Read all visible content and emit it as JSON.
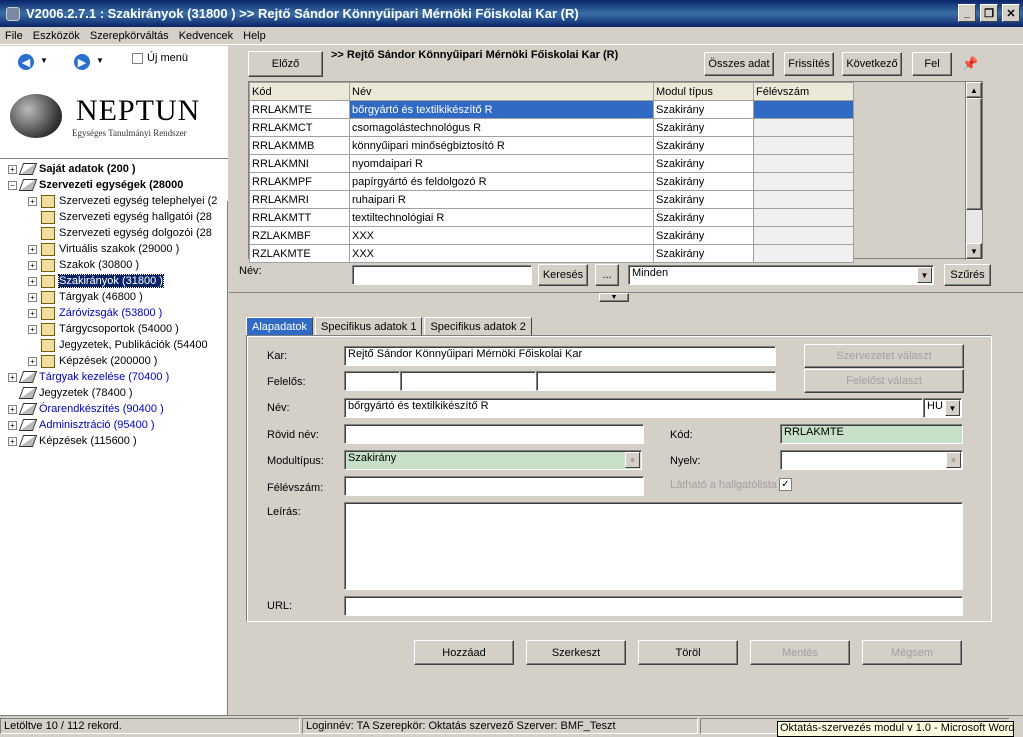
{
  "window": {
    "title": "V2006.2.7.1 : Szakirányok (31800  )  >> Rejtő Sándor Könnyűipari Mérnöki Főiskolai Kar (R)"
  },
  "menu": [
    "File",
    "Eszközök",
    "Szerepkörváltás",
    "Kedvencek",
    "Help"
  ],
  "nav": {
    "uj_menu_label": "Új menü",
    "logo_title": "NEPTUN",
    "logo_subtitle": "Egységes Tanulmányi Rendszer"
  },
  "tree": [
    {
      "label": "Saját adatok (200  )",
      "level": 0,
      "exp": "+",
      "bold": true
    },
    {
      "label": "Szervezeti egységek (28000",
      "level": 0,
      "exp": "−",
      "bold": true
    },
    {
      "label": "Szervezeti egység telephelyei (2",
      "level": 1,
      "exp": "+"
    },
    {
      "label": "Szervezeti egység hallgatói (28",
      "level": 1,
      "exp": ""
    },
    {
      "label": "Szervezeti egység dolgozói (28",
      "level": 1,
      "exp": ""
    },
    {
      "label": "Virtuális szakok (29000  )",
      "level": 1,
      "exp": "+"
    },
    {
      "label": "Szakok (30800  )",
      "level": 1,
      "exp": "+"
    },
    {
      "label": "Szakirányok (31800  )",
      "level": 1,
      "exp": "+",
      "selected": true
    },
    {
      "label": "Tárgyak (46800  )",
      "level": 1,
      "exp": "+"
    },
    {
      "label": "Záróvizsgák (53800  )",
      "level": 1,
      "exp": "+",
      "blue": true
    },
    {
      "label": "Tárgycsoportok (54000  )",
      "level": 1,
      "exp": "+"
    },
    {
      "label": "Jegyzetek, Publikációk (54400",
      "level": 1,
      "exp": ""
    },
    {
      "label": "Képzések (200000  )",
      "level": 1,
      "exp": "+"
    },
    {
      "label": "Tárgyak kezelése (70400  )",
      "level": 0,
      "exp": "+",
      "blue": true
    },
    {
      "label": "Jegyzetek (78400  )",
      "level": 0,
      "exp": ""
    },
    {
      "label": "Órarendkészítés (90400  )",
      "level": 0,
      "exp": "+",
      "blue": true
    },
    {
      "label": "Adminisztráció (95400  )",
      "level": 0,
      "exp": "+",
      "blue": true
    },
    {
      "label": "Képzések (115600  )",
      "level": 0,
      "exp": "+"
    }
  ],
  "toolbar": {
    "prev": "Előző",
    "header": ">> Rejtő Sándor Könnyűipari Mérnöki Főiskolai Kar (R)",
    "all_data": "Összes adat",
    "refresh": "Frissítés",
    "next": "Következő",
    "up": "Fel"
  },
  "grid": {
    "columns": [
      "Kód",
      "Név",
      "Modul típus",
      "Félévszám"
    ],
    "rows": [
      [
        "RRLAKMTE",
        "bőrgyártó és textilkikészítő  R",
        "Szakirány",
        ""
      ],
      [
        "RRLAKMCT",
        "csomagolástechnológus  R",
        "Szakirány",
        ""
      ],
      [
        "RRLAKMMB",
        "könnyűipari minőségbiztosító  R",
        "Szakirány",
        ""
      ],
      [
        "RRLAKMNI",
        "nyomdaipari  R",
        "Szakirány",
        ""
      ],
      [
        "RRLAKMPF",
        "papírgyártó és feldolgozó  R",
        "Szakirány",
        ""
      ],
      [
        "RRLAKMRI",
        "ruhaipari  R",
        "Szakirány",
        ""
      ],
      [
        "RRLAKMTT",
        "textiltechnológiai  R",
        "Szakirány",
        ""
      ],
      [
        "RZLAKMBF",
        "XXX",
        "Szakirány",
        ""
      ],
      [
        "RZLAKMTE",
        "XXX",
        "Szakirány",
        ""
      ]
    ]
  },
  "filter": {
    "label": "Név:",
    "value": "",
    "search": "Keresés",
    "ellipsis": "...",
    "mode": "Minden",
    "filter_btn": "Szűrés"
  },
  "tabs": [
    "Alapadatok",
    "Specifikus adatok 1",
    "Specifikus adatok 2"
  ],
  "form": {
    "kar_label": "Kar:",
    "kar_value": "Rejtő Sándor Könnyűipari Mérnöki Főiskolai Kar",
    "org_select": "Szervezetet választ",
    "felelos_label": "Felelős:",
    "felelos_select": "Felelőst választ",
    "nev_label": "Név:",
    "nev_value": "bőrgyártó és textilkikészítő  R",
    "lang": "HU",
    "rovid_label": "Rövid név:",
    "rovid_value": "",
    "kod_label": "Kód:",
    "kod_value": "RRLAKMTE",
    "modul_label": "Modultípus:",
    "modul_value": "Szakirány",
    "nyelv_label": "Nyelv:",
    "nyelv_value": "",
    "felev_label": "Félévszám:",
    "felev_value": "",
    "lathato_label": "Látható a hallgatólista",
    "leiras_label": "Leírás:",
    "url_label": "URL:"
  },
  "actions": {
    "add": "Hozzáad",
    "edit": "Szerkeszt",
    "delete": "Töröl",
    "save": "Mentés",
    "cancel": "Mégsem"
  },
  "status": {
    "records": "Letöltve 10 / 112 rekord.",
    "login": "Loginnév: TA   Szerepkör: Oktatás szervező   Szerver: BMF_Teszt",
    "tooltip": "Oktatás-szervezés modul v 1.0 - Microsoft Word"
  }
}
